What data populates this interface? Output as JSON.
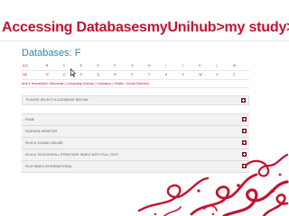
{
  "slide": {
    "title": "Accessing DatabasesmyUnihub>my study>my"
  },
  "page": {
    "heading": "Databases: F",
    "az_row1": [
      "A-E",
      "B",
      "C",
      "D",
      "E",
      "F",
      "G",
      "H",
      "I",
      "J",
      "K",
      "L",
      "M"
    ],
    "az_row2": [
      "NA",
      "N",
      "O",
      "P",
      "Q",
      "R",
      "S",
      "T",
      "U",
      "V",
      "W",
      "X",
      "Z"
    ],
    "subjects": [
      "Arts & Humanities",
      "Business",
      "Computing Science",
      "Education",
      "Health",
      "Social Sciences"
    ],
    "select_prompt": "PLEASE SELECT A DATABASE BELOW",
    "databases": [
      "FAME",
      "FASHION MONITOR",
      "FILM & SOUND ONLINE",
      "FILM & TELEVISION LITERATURE INDEX WITH FULL TEXT",
      "FILM INDEX INTERNATIONAL"
    ]
  },
  "colors": {
    "accent": "#c4122f",
    "heading_blue": "#2f7fb8",
    "row_bg": "#f2f2f2",
    "plus_button": "#7a1220"
  },
  "icons": {
    "expand": "plus-icon",
    "pointer": "mouse-cursor-icon",
    "decoration": "red-swirl-decoration"
  }
}
